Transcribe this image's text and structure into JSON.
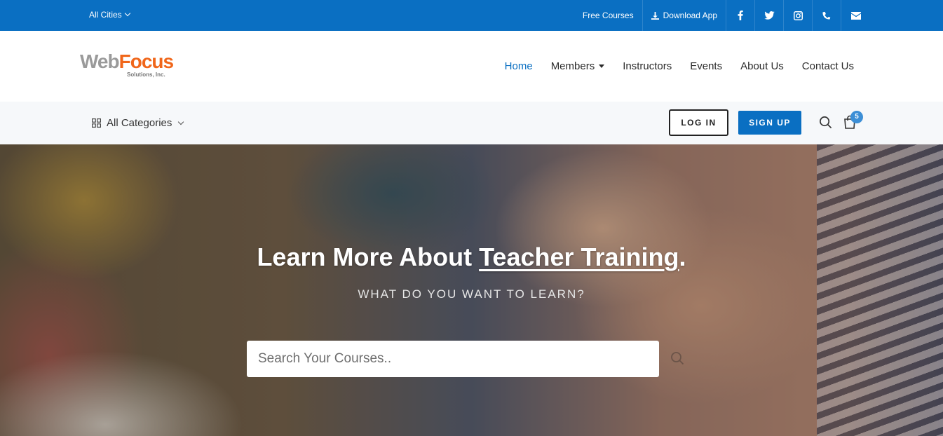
{
  "topbar": {
    "city_selector": "All Cities",
    "free_courses": "Free Courses",
    "download_app": "Download App",
    "icons": [
      "facebook-icon",
      "twitter-icon",
      "instagram-icon",
      "phone-icon",
      "envelope-icon"
    ]
  },
  "header": {
    "logo": {
      "part1": "Web",
      "part2": "Focus",
      "tagline": "Solutions, Inc."
    },
    "nav": [
      {
        "label": "Home",
        "active": true
      },
      {
        "label": "Members",
        "has_dropdown": true
      },
      {
        "label": "Instructors"
      },
      {
        "label": "Events"
      },
      {
        "label": "About Us"
      },
      {
        "label": "Contact Us"
      }
    ]
  },
  "catbar": {
    "categories_label": "All Categories",
    "login_label": "LOG IN",
    "signup_label": "SIGN UP",
    "cart_count": "5"
  },
  "hero": {
    "title_prefix": "Learn More About ",
    "title_highlight": "Teacher Training",
    "title_suffix": ".",
    "subtitle": "WHAT DO YOU WANT TO LEARN?",
    "search_placeholder": "Search Your Courses.."
  },
  "colors": {
    "primary": "#0a6fc2",
    "logo_gray": "#9a9a9a",
    "logo_orange": "#f0661a",
    "badge": "#3d8fd6"
  }
}
